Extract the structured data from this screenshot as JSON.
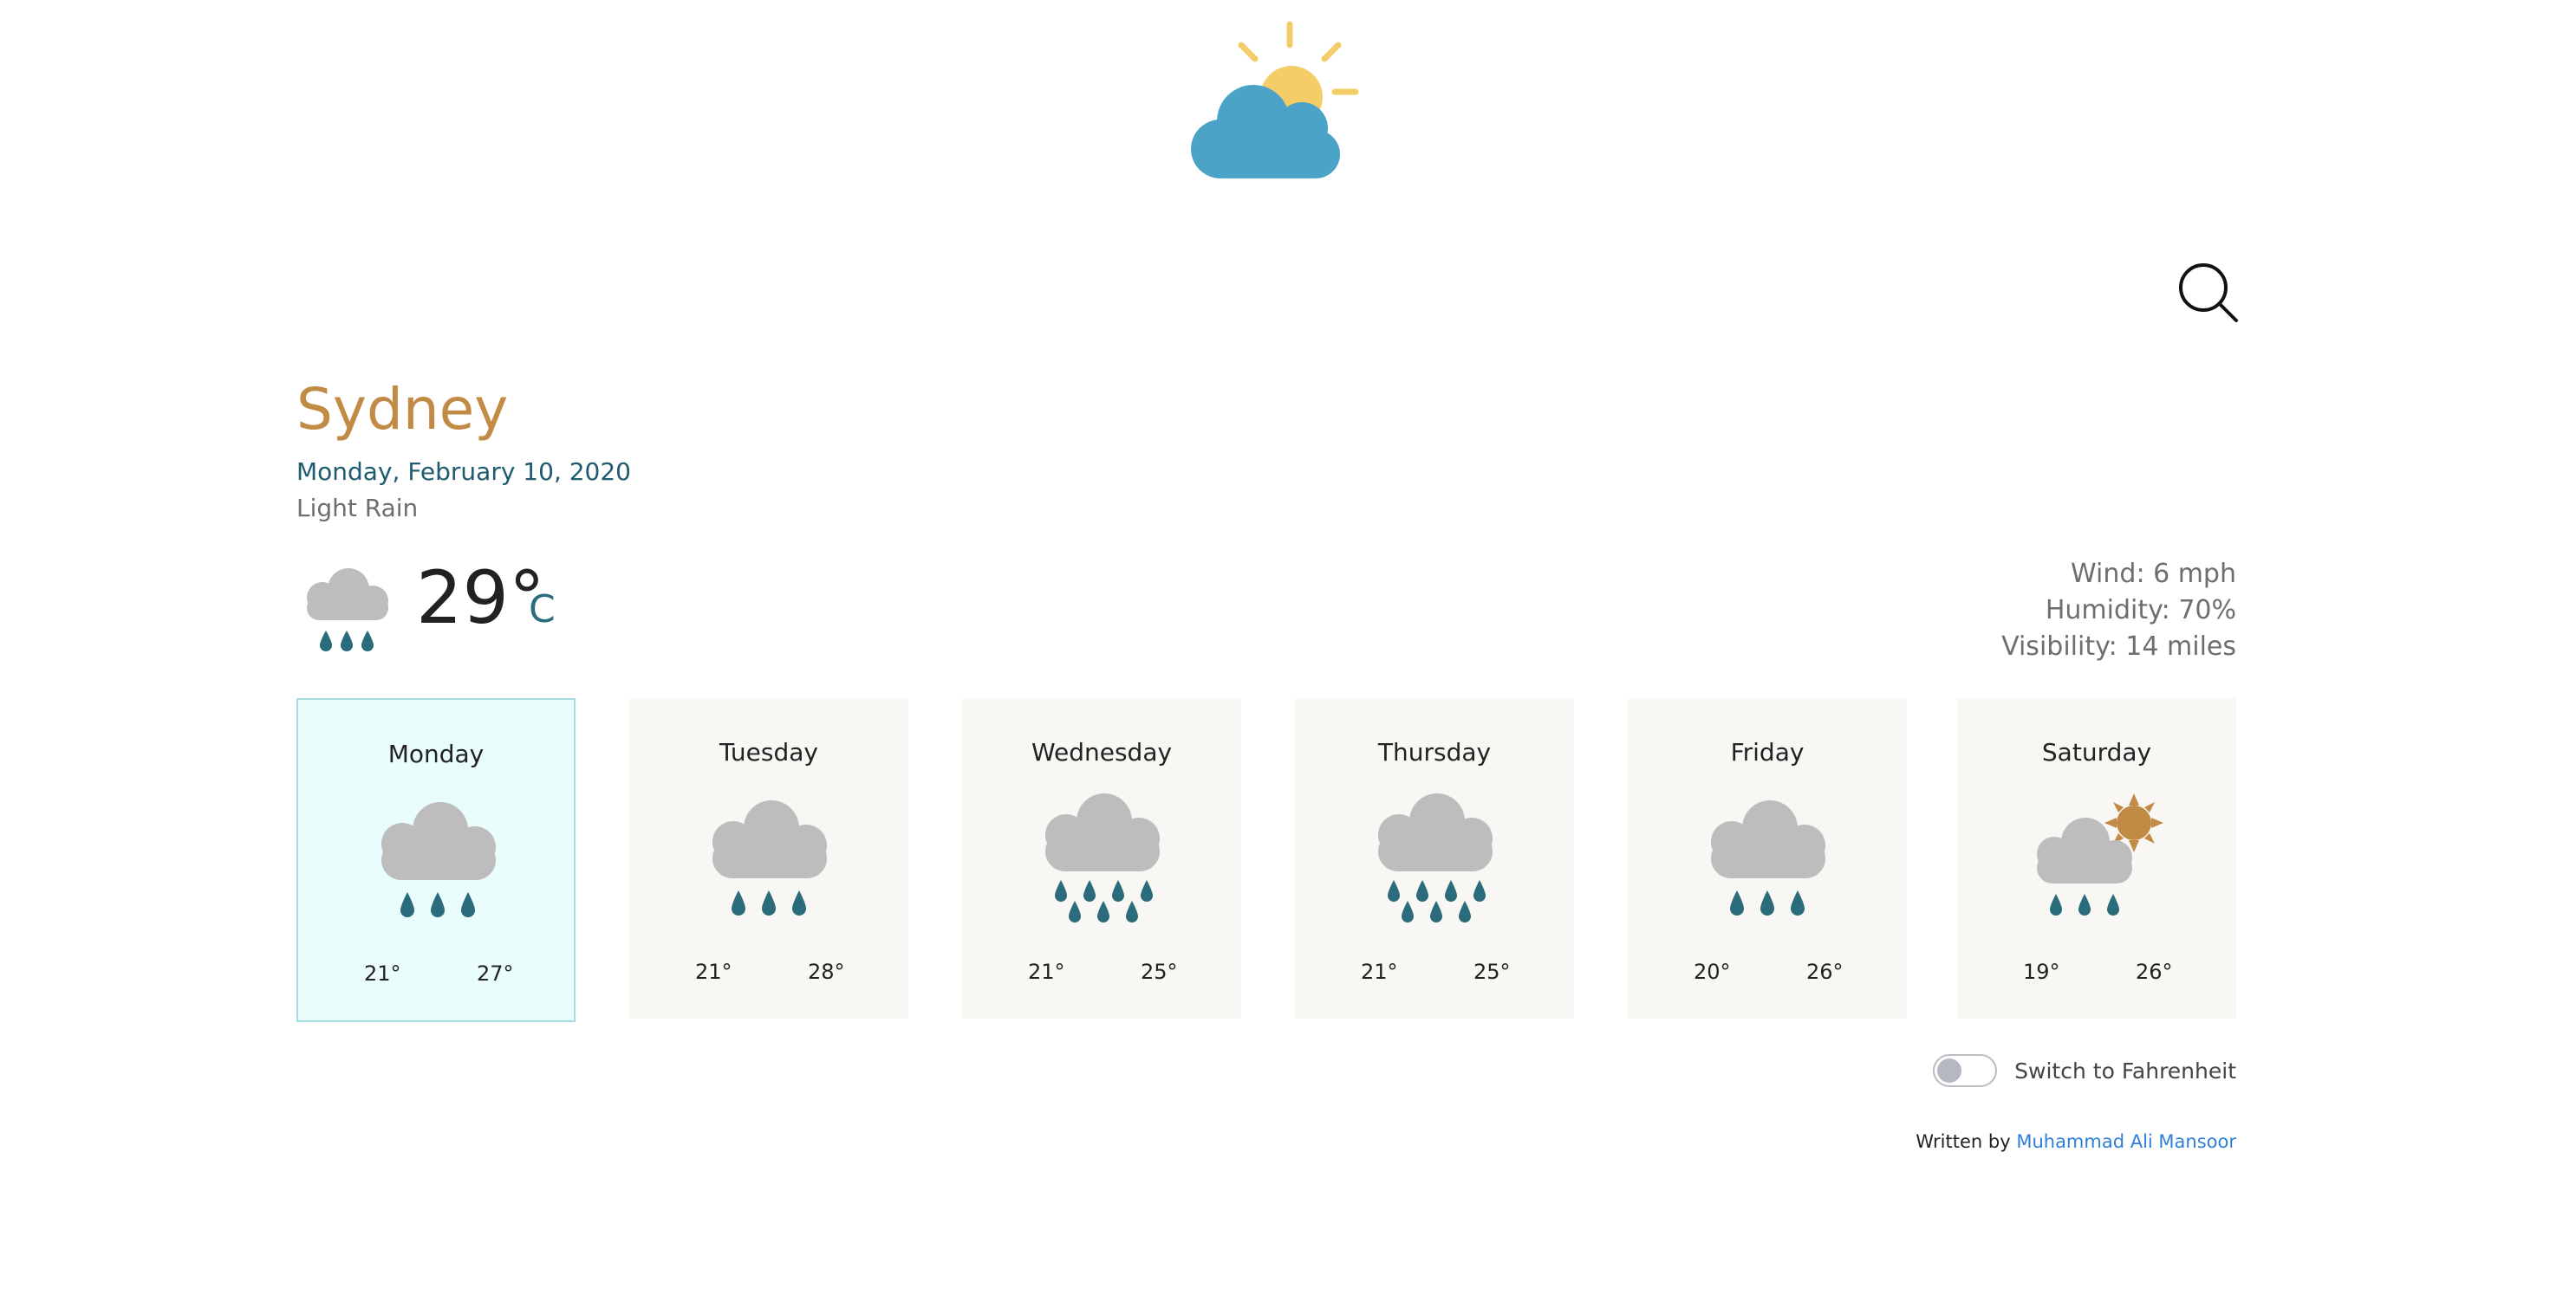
{
  "location": {
    "city": "Sydney",
    "date": "Monday, February 10, 2020",
    "condition": "Light Rain"
  },
  "current": {
    "temperature": "29°",
    "unit": "C",
    "icon": "rain-cloud-icon"
  },
  "details": {
    "wind": "Wind: 6 mph",
    "humidity": "Humidity: 70%",
    "visibility": "Visibility: 14 miles"
  },
  "forecast": [
    {
      "day": "Monday",
      "low": "21°",
      "high": "27°",
      "icon": "light-rain-icon",
      "selected": true
    },
    {
      "day": "Tuesday",
      "low": "21°",
      "high": "28°",
      "icon": "light-rain-icon"
    },
    {
      "day": "Wednesday",
      "low": "21°",
      "high": "25°",
      "icon": "heavy-rain-icon"
    },
    {
      "day": "Thursday",
      "low": "21°",
      "high": "25°",
      "icon": "heavy-rain-icon"
    },
    {
      "day": "Friday",
      "low": "20°",
      "high": "26°",
      "icon": "light-rain-icon"
    },
    {
      "day": "Saturday",
      "low": "19°",
      "high": "26°",
      "icon": "sun-rain-icon"
    }
  ],
  "toggle": {
    "label": "Switch to Fahrenheit"
  },
  "footer": {
    "prefix": "Written by",
    "author": "Muhammad Ali Mansoor"
  },
  "colors": {
    "accent_city": "#c28b45",
    "date": "#1e5b6e",
    "raindrop": "#2a6b7c",
    "cloud_gray": "#bdbdbd",
    "logo_cloud": "#4ba3c8",
    "logo_sun": "#f4cd69",
    "saturday_sun": "#c28b45",
    "active_card_bg": "#e9fdfd"
  }
}
